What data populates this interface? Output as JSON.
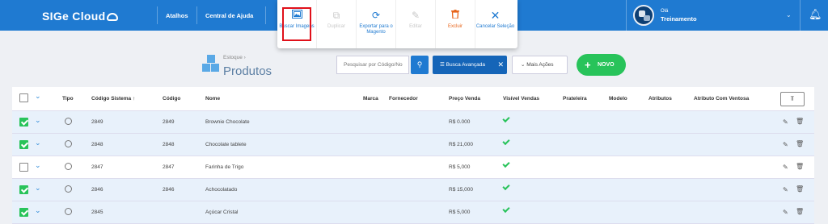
{
  "header": {
    "logo": "SIGe Cloud",
    "nav": [
      "Atalhos",
      "Central de Ajuda"
    ],
    "user_greeting": "Olá",
    "user_name": "Treinamento"
  },
  "action_menu": [
    {
      "label": "Buscar Imagens",
      "icon": "image-icon",
      "style": "blue",
      "highlighted": true
    },
    {
      "label": "Duplicar",
      "icon": "duplicate-icon",
      "style": "gray"
    },
    {
      "label": "Exportar para o Magento",
      "icon": "sync-icon",
      "style": "blue"
    },
    {
      "label": "Editar",
      "icon": "pencil-icon",
      "style": "gray"
    },
    {
      "label": "Excluir",
      "icon": "trash-icon",
      "style": "orange"
    },
    {
      "label": "Cancelar Seleção",
      "icon": "close-icon",
      "style": "blue"
    }
  ],
  "page": {
    "breadcrumb": "Estoque",
    "title": "Produtos",
    "search_placeholder": "Pesquisar por Código/No",
    "advanced_search": "Busca Avançada",
    "more_actions": "Mais Ações",
    "new_button": "NOVO"
  },
  "table": {
    "columns": [
      "Tipo",
      "Código Sistema",
      "Código",
      "Nome",
      "Marca",
      "Fornecedor",
      "Preço Venda",
      "Visível Vendas",
      "Prateleira",
      "Modelo",
      "Atributos",
      "Atributo Com Ventosa"
    ],
    "sort_indicator": "↑",
    "rows": [
      {
        "selected": true,
        "codigo_sistema": "2849",
        "codigo": "2849",
        "nome": "Brownie Chocolate",
        "preco": "R$ 0.000",
        "visivel": true
      },
      {
        "selected": true,
        "codigo_sistema": "2848",
        "codigo": "2848",
        "nome": "Chocolate tablete",
        "preco": "R$ 21,000",
        "visivel": true
      },
      {
        "selected": false,
        "codigo_sistema": "2847",
        "codigo": "2847",
        "nome": "Farinha de Trigo",
        "preco": "R$ 5,000",
        "visivel": true
      },
      {
        "selected": true,
        "codigo_sistema": "2846",
        "codigo": "2846",
        "nome": "Achocolatado",
        "preco": "R$ 15,000",
        "visivel": true
      },
      {
        "selected": true,
        "codigo_sistema": "2845",
        "codigo": "",
        "nome": "Açúcar Cristal",
        "preco": "R$ 5,000",
        "visivel": true
      }
    ]
  },
  "colors": {
    "primary": "#1f7ad1",
    "green": "#28c35a",
    "orange": "#e8661d",
    "highlight": "#e0101a"
  }
}
